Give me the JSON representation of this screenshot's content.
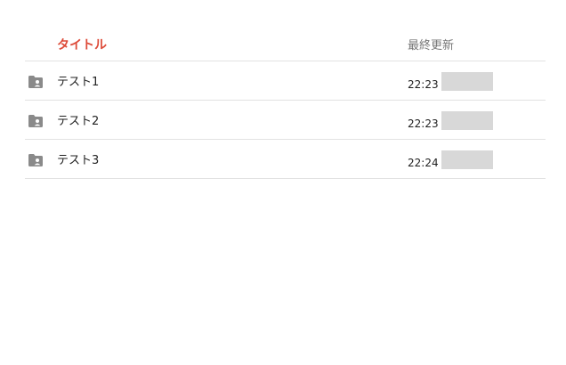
{
  "header": {
    "title_label": "タイトル",
    "modified_label": "最終更新"
  },
  "colors": {
    "accent": "#dd4b39",
    "icon": "#8a8a8a",
    "divider": "#e2e2e2",
    "redacted": "#d8d8d8"
  },
  "items": [
    {
      "name": "テスト1",
      "time": "22:23",
      "icon": "shared-folder-icon"
    },
    {
      "name": "テスト2",
      "time": "22:23",
      "icon": "shared-folder-icon"
    },
    {
      "name": "テスト3",
      "time": "22:24",
      "icon": "shared-folder-icon"
    }
  ]
}
